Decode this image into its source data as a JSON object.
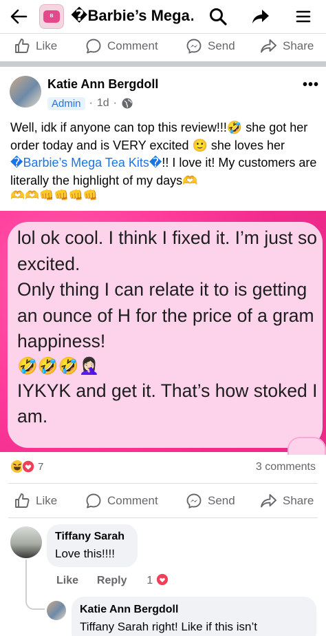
{
  "topbar": {
    "title": "�Barbie’s Mega…",
    "back_icon": "arrow-left-icon",
    "search_icon": "search-icon",
    "share_icon": "share-arrow-icon",
    "menu_icon": "hamburger-icon"
  },
  "top_actions": {
    "like": "Like",
    "comment": "Comment",
    "send": "Send",
    "share": "Share"
  },
  "post": {
    "author": "Katie Ann Bergdoll",
    "badge": "Admin",
    "time": "1d",
    "separator": "·",
    "audience_icon": "globe-icon",
    "text_part1": "Well, idk if anyone can top this review!!!🤣 she got her order today and is VERY excited 🙂 she loves her ",
    "text_link": "�Barbie’s Mega Tea Kits�",
    "text_part2": "!! I love it! My customers are literally the highlight of my days🫶",
    "text_emoji_row": "🫶🫶👊👊👊👊",
    "image_text_line1": "lol ok cool. I think I fixed it. I’m just so excited.",
    "image_text_line2": "Only thing I can relate it to is getting an ounce of H for the price of a gram happiness!",
    "image_text_emoji": "🤣🤣🤣🤦🏻‍♀️",
    "image_text_line3": "IYKYK and get it. That’s how stoked I am.",
    "reactions_count": "7",
    "comments_count": "3 comments",
    "colors": {
      "link": "#1b74e4",
      "image_bg": "#f02b8c",
      "bubble": "#fdd3ec"
    }
  },
  "post_actions": {
    "like": "Like",
    "comment": "Comment",
    "send": "Send",
    "share": "Share"
  },
  "comments": [
    {
      "name": "Tiffany Sarah",
      "text": "Love this!!!!",
      "like_label": "Like",
      "reply_label": "Reply",
      "reaction_count": "1"
    },
    {
      "name": "Katie Ann Bergdoll",
      "text": "Tiffany Sarah right! Like if this isn’t"
    }
  ]
}
